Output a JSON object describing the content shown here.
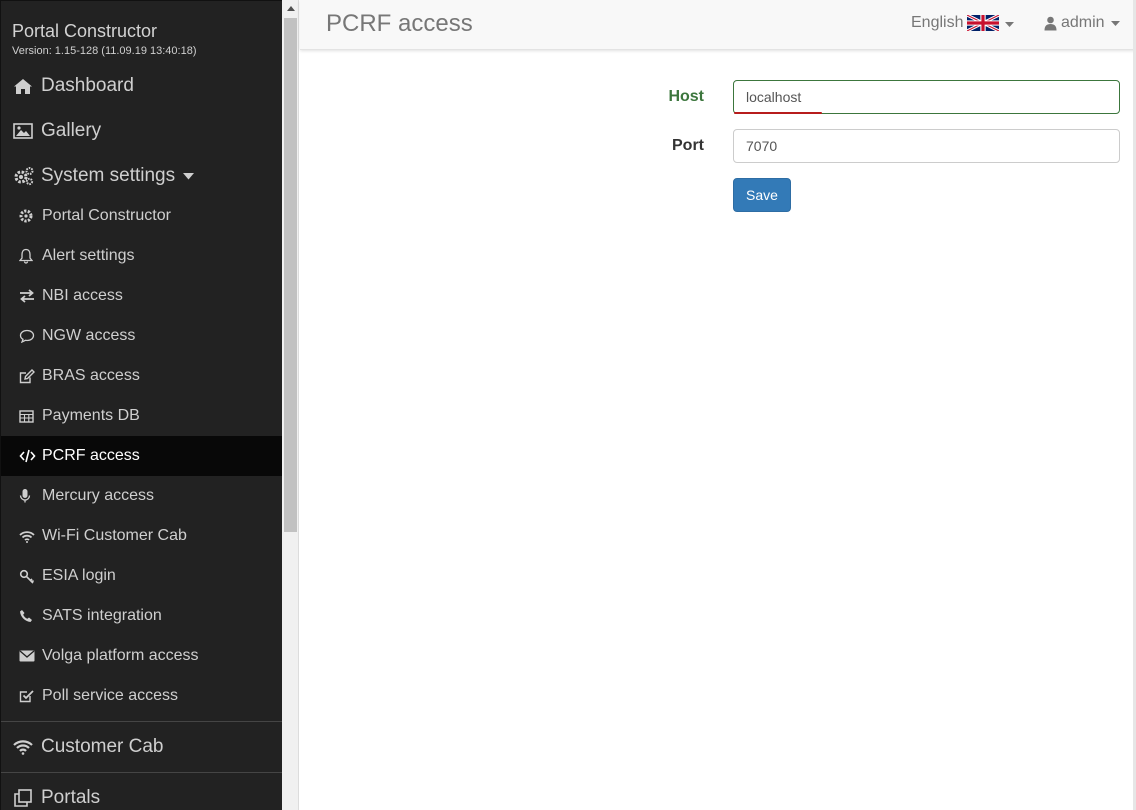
{
  "app": {
    "brand": "Portal Constructor",
    "version": "Version: 1.15-128 (11.09.19 13:40:18)"
  },
  "sidebar": {
    "top_items": [
      {
        "label": "Dashboard",
        "icon": "home-icon"
      },
      {
        "label": "Gallery",
        "icon": "picture-icon"
      },
      {
        "label": "System settings",
        "icon": "cogs-icon",
        "expanded": true
      }
    ],
    "sub_items": [
      {
        "label": "Portal Constructor",
        "icon": "gear-icon"
      },
      {
        "label": "Alert settings",
        "icon": "bell-icon"
      },
      {
        "label": "NBI access",
        "icon": "exchange-icon"
      },
      {
        "label": "NGW access",
        "icon": "comment-icon"
      },
      {
        "label": "BRAS access",
        "icon": "edit-icon"
      },
      {
        "label": "Payments DB",
        "icon": "table-icon"
      },
      {
        "label": "PCRF access",
        "icon": "code-icon",
        "active": true
      },
      {
        "label": "Mercury access",
        "icon": "microphone-icon"
      },
      {
        "label": "Wi-Fi Customer Cab",
        "icon": "wifi-icon"
      },
      {
        "label": "ESIA login",
        "icon": "key-icon"
      },
      {
        "label": "SATS integration",
        "icon": "phone-icon"
      },
      {
        "label": "Volga platform access",
        "icon": "envelope-icon"
      },
      {
        "label": "Poll service access",
        "icon": "check-square-icon"
      }
    ],
    "bottom_items": [
      {
        "label": "Customer Cab",
        "icon": "wifi-icon"
      },
      {
        "label": "Portals",
        "icon": "clone-icon"
      }
    ]
  },
  "header": {
    "title": "PCRF access",
    "language": "English",
    "user": "admin"
  },
  "form": {
    "host_label": "Host",
    "host_value": "localhost",
    "port_label": "Port",
    "port_value": "7070",
    "save_label": "Save"
  },
  "colors": {
    "sidebar_bg": "#222222",
    "active_bg": "#080808",
    "primary": "#337ab7",
    "success": "#3c763d"
  }
}
